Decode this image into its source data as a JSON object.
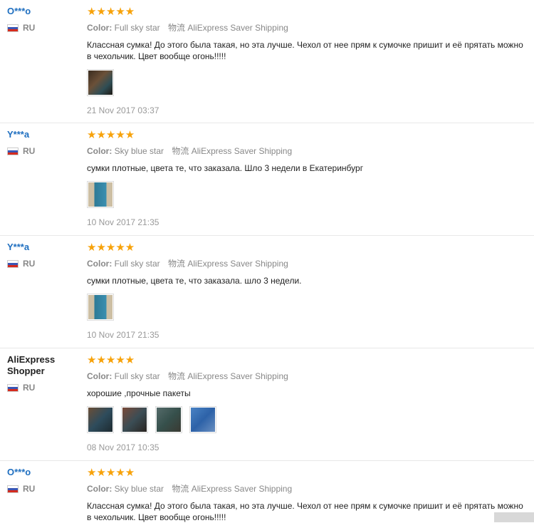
{
  "ship_icon_text": "物流",
  "reviews": [
    {
      "user": "O***o",
      "country": "RU",
      "stars": "★★★★★",
      "color_label": "Color:",
      "color_value": "Full sky star",
      "shipping": "AliExpress Saver Shipping",
      "text": "Классная сумка! До этого была такая, но эта лучше. Чехол от нее прям к сумочке пришит и её прятать можно в чехольчик. Цвет вообще огонь!!!!!",
      "date": "21 Nov 2017 03:37",
      "photo_colors": [
        "#5b4330"
      ]
    },
    {
      "user": "Y***a",
      "country": "RU",
      "stars": "★★★★★",
      "color_label": "Color:",
      "color_value": "Sky blue star",
      "shipping": "AliExpress Saver Shipping",
      "text": "сумки плотные, цвета те, что заказала. Шло 3 недели в Екатеринбург",
      "date": "10 Nov 2017 21:35",
      "photo_colors": [
        "#3c7fa0"
      ]
    },
    {
      "user": "Y***a",
      "country": "RU",
      "stars": "★★★★★",
      "color_label": "Color:",
      "color_value": "Full sky star",
      "shipping": "AliExpress Saver Shipping",
      "text": "сумки плотные, цвета те, что заказала. шло 3 недели.",
      "date": "10 Nov 2017 21:35",
      "photo_colors": [
        "#3c7fa0"
      ]
    },
    {
      "user": "AliExpress Shopper",
      "country": "RU",
      "stars": "★★★★★",
      "color_label": "Color:",
      "color_value": "Full sky star",
      "shipping": "AliExpress Saver Shipping",
      "text": "хорошие ,прочные пакеты",
      "date": "08 Nov 2017 10:35",
      "photo_colors": [
        "#2f4d5e",
        "#6a4b3b",
        "#3d5a56",
        "#3a6fb0"
      ]
    },
    {
      "user": "O***o",
      "country": "RU",
      "stars": "★★★★★",
      "color_label": "Color:",
      "color_value": "Sky blue star",
      "shipping": "AliExpress Saver Shipping",
      "text": "Классная сумка! До этого была такая, но эта лучше. Чехол от нее прям к сумочке пришит и её прятать можно в чехольчик. Цвет вообще огонь!!!!!",
      "date": "",
      "photo_colors": []
    }
  ]
}
